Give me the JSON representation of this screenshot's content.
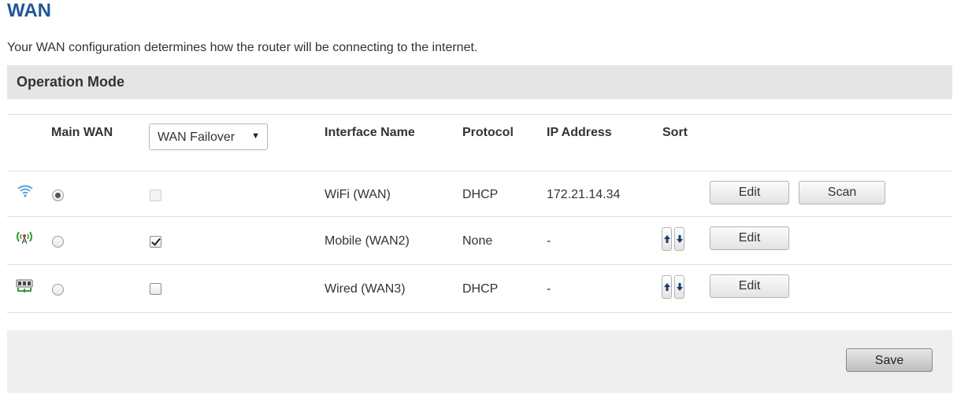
{
  "page": {
    "title": "WAN",
    "description": "Your WAN configuration determines how the router will be connecting to the internet."
  },
  "section": {
    "title": "Operation Mode"
  },
  "table": {
    "headers": {
      "main_wan": "Main WAN",
      "interface_name": "Interface Name",
      "protocol": "Protocol",
      "ip_address": "IP Address",
      "sort": "Sort"
    },
    "mode_select": {
      "value": "WAN Failover"
    },
    "rows": [
      {
        "icon": "wifi-icon",
        "main_wan_selected": true,
        "enabled_checkbox": "disabled",
        "interface": "WiFi (WAN)",
        "protocol": "DHCP",
        "ip": "172.21.14.34",
        "edit_label": "Edit",
        "scan_label": "Scan"
      },
      {
        "icon": "mobile-antenna-icon",
        "main_wan_selected": false,
        "enabled_checkbox": "checked",
        "interface": "Mobile (WAN2)",
        "protocol": "None",
        "ip": "-",
        "edit_label": "Edit"
      },
      {
        "icon": "wired-ethernet-icon",
        "main_wan_selected": false,
        "enabled_checkbox": "unchecked",
        "interface": "Wired (WAN3)",
        "protocol": "DHCP",
        "ip": "-",
        "edit_label": "Edit"
      }
    ]
  },
  "footer": {
    "save_label": "Save"
  },
  "colors": {
    "title": "#1f5597",
    "section_bg": "#e5e5e5",
    "footer_bg": "#efefef",
    "wifi": "#5aa0d8",
    "mobile": "#3a9a3a"
  }
}
